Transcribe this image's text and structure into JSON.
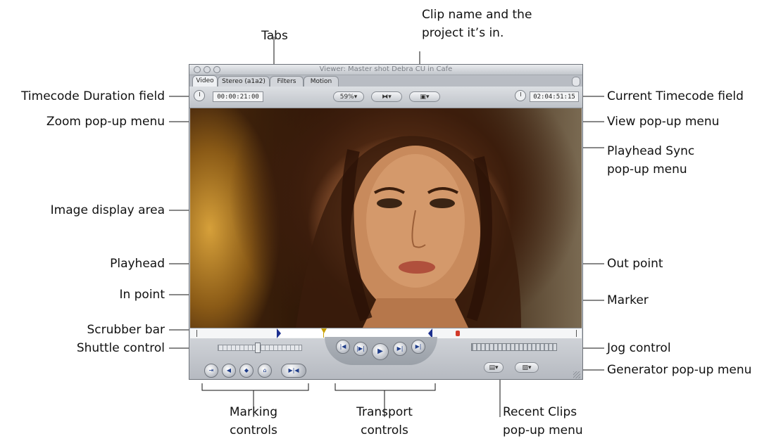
{
  "window": {
    "title": "Viewer: Master shot Debra CU in Cafe",
    "tabs": [
      "Video",
      "Stereo (a1a2)",
      "Filters",
      "Motion"
    ],
    "timecode_duration": "00:00:21:00",
    "current_timecode": "02:04:51:15",
    "zoom": "59%"
  },
  "callouts": {
    "tabs": "Tabs",
    "clip_name_line1": "Clip name and the",
    "clip_name_line2": "project it’s in.",
    "timecode_duration_field": "Timecode Duration field",
    "zoom_popup": "Zoom pop-up menu",
    "image_display_area": "Image display area",
    "playhead": "Playhead",
    "in_point": "In point",
    "scrubber_bar": "Scrubber bar",
    "shuttle_control": "Shuttle control",
    "marking_controls_line1": "Marking",
    "marking_controls_line2": "controls",
    "transport_controls_line1": "Transport",
    "transport_controls_line2": "controls",
    "recent_clips_line1": "Recent Clips",
    "recent_clips_line2": "pop-up menu",
    "current_timecode_field": "Current Timecode field",
    "view_popup": "View pop-up menu",
    "playhead_sync_line1": "Playhead Sync",
    "playhead_sync_line2": "pop-up menu",
    "out_point": "Out point",
    "marker": "Marker",
    "jog_control": "Jog control",
    "generator_popup": "Generator pop-up menu"
  },
  "colors": {
    "in_out_marker": "#1b2f8f",
    "marker": "#d23a2a",
    "playhead": "#c9a000",
    "transport_glyph": "#1f3d8a"
  },
  "icons": {
    "marking": [
      "mark-clip-icon",
      "mark-in-icon",
      "add-marker-icon",
      "add-keyframe-icon",
      "mark-in-out-icon"
    ],
    "transport": [
      "go-to-in-icon",
      "play-in-to-out-icon",
      "play-icon",
      "play-around-icon",
      "go-to-out-icon"
    ]
  }
}
